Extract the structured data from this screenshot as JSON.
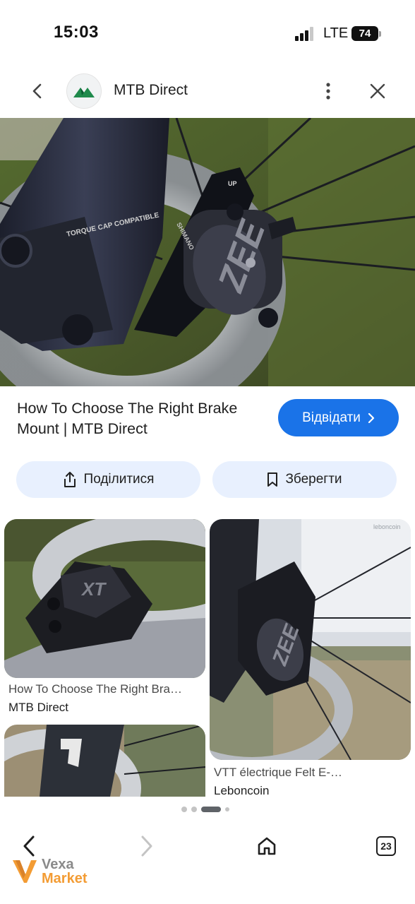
{
  "status_bar": {
    "time": "15:03",
    "network": "LTE",
    "battery": "74"
  },
  "header": {
    "site_name": "MTB Direct"
  },
  "main_image": {
    "decal_text": "TORQUE CAP COMPATIBLE",
    "caliper_text": "SHIMANO",
    "caliper_logo": "ZEE",
    "mount_text": "UP"
  },
  "result": {
    "title": "How To Choose The Right Brake Mount | MTB Direct",
    "visit_label": "Відвідати"
  },
  "actions": {
    "share_label": "Поділитися",
    "save_label": "Зберегти"
  },
  "grid": [
    {
      "title": "How To Choose The Right Bra…",
      "source": "MTB Direct"
    },
    {
      "title": "VTT électrique Felt E-…",
      "source": "Leboncoin"
    },
    {
      "title": "",
      "source": ""
    }
  ],
  "bottom_nav": {
    "tab_count": "23"
  },
  "watermark": {
    "line1": "Vexa",
    "line2": "Market"
  },
  "colors": {
    "accent": "#1a73e8",
    "chip_bg": "#e8f0fe",
    "logo_green": "#1f8a4c",
    "watermark_orange": "#f39c34"
  },
  "icons": [
    "back-arrow-icon",
    "more-vert-icon",
    "close-icon",
    "share-icon",
    "bookmark-icon",
    "chevron-right-icon",
    "home-icon",
    "forward-arrow-icon"
  ]
}
